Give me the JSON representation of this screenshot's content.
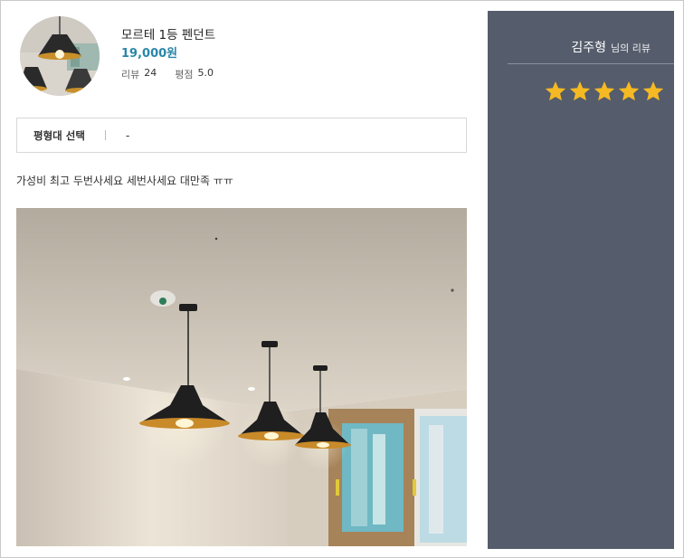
{
  "product": {
    "name": "모르테 1등 펜던트",
    "price": "19,000원",
    "review_label": "리뷰",
    "review_count": "24",
    "rating_label": "평점",
    "rating_value": "5.0"
  },
  "option": {
    "label": "평형대 선택",
    "value": "-"
  },
  "review": {
    "text": "가성비 최고 두번사세요 세번사세요 대만족 ㅠㅠ"
  },
  "reviewer": {
    "name": "김주형",
    "suffix": "님의 리뷰",
    "stars": 5,
    "star_color": "#f5b923"
  },
  "colors": {
    "price": "#2a86a8",
    "panel_bg": "#555c6b"
  }
}
